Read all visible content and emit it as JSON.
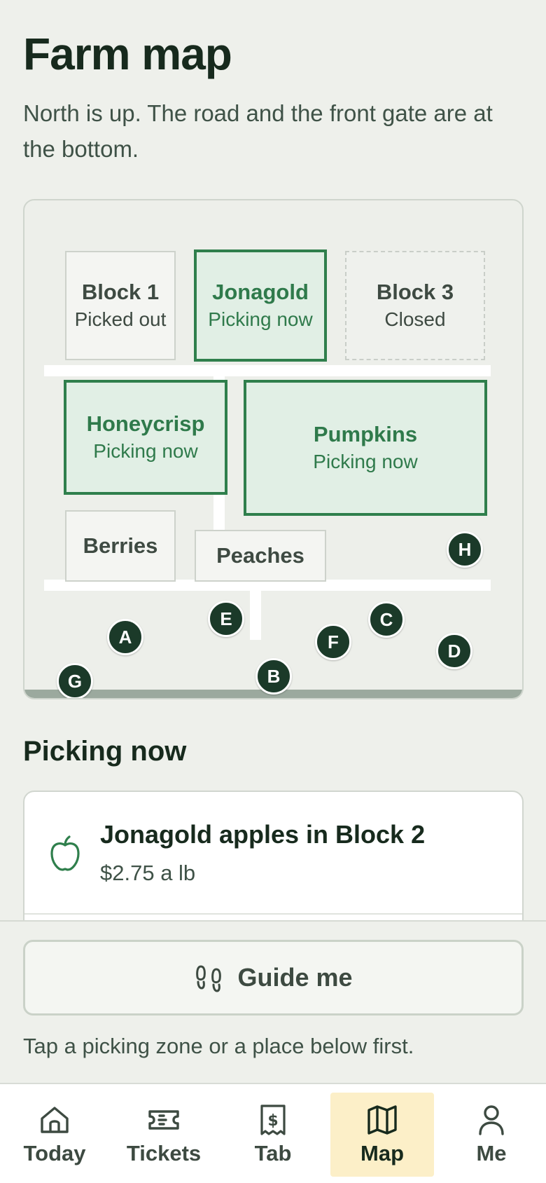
{
  "page": {
    "title": "Farm map",
    "subtitle": "North is up. The road and the front gate are at the bottom."
  },
  "map": {
    "blocks": [
      {
        "name": "Block 1",
        "status": "Picked out"
      },
      {
        "name": "Jonagold",
        "status": "Picking now"
      },
      {
        "name": "Block 3",
        "status": "Closed"
      },
      {
        "name": "Honeycrisp",
        "status": "Picking now"
      },
      {
        "name": "Pumpkins",
        "status": "Picking now"
      },
      {
        "name": "Berries"
      },
      {
        "name": "Peaches"
      }
    ],
    "markers": [
      "A",
      "B",
      "C",
      "D",
      "E",
      "F",
      "G",
      "H"
    ]
  },
  "picking": {
    "heading": "Picking now",
    "items": [
      {
        "title": "Jonagold apples in Block 2",
        "price": "$2.75 a lb",
        "icon": "apple-icon"
      }
    ]
  },
  "guide": {
    "button_label": "Guide me",
    "icon": "footprints-icon",
    "hint": "Tap a picking zone or a place below first."
  },
  "tabs": [
    {
      "label": "Today",
      "icon": "home-icon"
    },
    {
      "label": "Tickets",
      "icon": "ticket-icon"
    },
    {
      "label": "Tab",
      "icon": "receipt-icon"
    },
    {
      "label": "Map",
      "icon": "map-icon",
      "active": true
    },
    {
      "label": "Me",
      "icon": "user-icon"
    }
  ],
  "colors": {
    "background": "#eef0eb",
    "accent_green": "#2f7f4c",
    "active_fill": "#e1efe5",
    "marker": "#1b3a29",
    "active_tab": "#fcefc8"
  }
}
